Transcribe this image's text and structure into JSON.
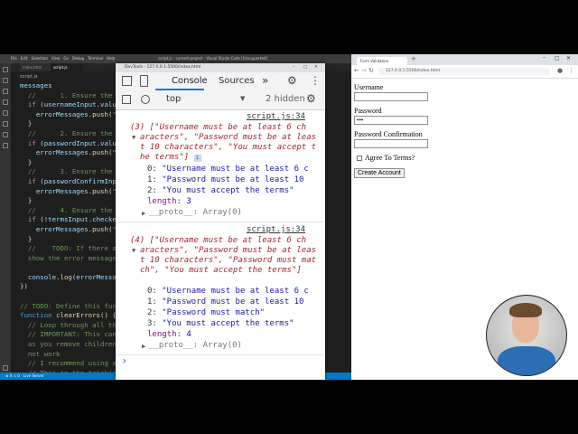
{
  "vscode": {
    "title": "script.js - current-project - Visual Studio Code [Unsupported]",
    "menu": [
      "File",
      "Edit",
      "Selection",
      "View",
      "Go",
      "Debug",
      "Terminal",
      "Help"
    ],
    "tabs": [
      "index.html",
      "script.js"
    ],
    "breadcrumb": "script.js",
    "status_left": "⊗ 0 ⚠ 0",
    "status_mid": "Live Server"
  },
  "devtools": {
    "window_title": "DevTools - 127.0.0.1:5500/index.html",
    "tabs": {
      "console": "Console",
      "sources": "Sources",
      "more": "»"
    },
    "context": "top",
    "hidden_count": "2 hidden",
    "entries": [
      {
        "source": "script.js:34",
        "summary": [
          "(3) [\"Username must be at least 6 ch",
          "aracters\", \"Password must be at leas",
          "t 10 characters\", \"You must accept t",
          "he terms\"]"
        ],
        "items": [
          {
            "index": "0:",
            "value": "\"Username must be at least 6 c"
          },
          {
            "index": "1:",
            "value": "\"Password must be at least 10 "
          },
          {
            "index": "2:",
            "value": "\"You must accept the terms\""
          }
        ],
        "length_label": "length:",
        "length": "3",
        "proto": "__proto__: Array(0)"
      },
      {
        "source": "script.js:34",
        "summary": [
          "(4) [\"Username must be at least 6 ch",
          "aracters\", \"Password must be at leas",
          "t 10 characters\", \"Password must mat",
          "ch\", \"You must accept the terms\"]"
        ],
        "items": [
          {
            "index": "0:",
            "value": "\"Username must be at least 6 c"
          },
          {
            "index": "1:",
            "value": "\"Password must be at least 10 "
          },
          {
            "index": "2:",
            "value": "\"Password must match\""
          },
          {
            "index": "3:",
            "value": "\"You must accept the terms\""
          }
        ],
        "length_label": "length:",
        "length": "4",
        "proto": "__proto__: Array(0)"
      }
    ],
    "prompt": "›"
  },
  "chrome": {
    "tab_title": "Form Validation",
    "url": "127.0.0.1:5500/index.html",
    "form": {
      "username_label": "Username",
      "username_value": "",
      "password_label": "Password",
      "password_value": "•••",
      "confirm_label": "Password Confirmation",
      "confirm_value": "",
      "terms_label": "Agree To Terms?",
      "submit_label": "Create Account"
    }
  },
  "colors": {
    "vscode_bg": "#1e1e1e",
    "status_bar": "#007acc",
    "devtools_accent": "#1a73e8"
  }
}
